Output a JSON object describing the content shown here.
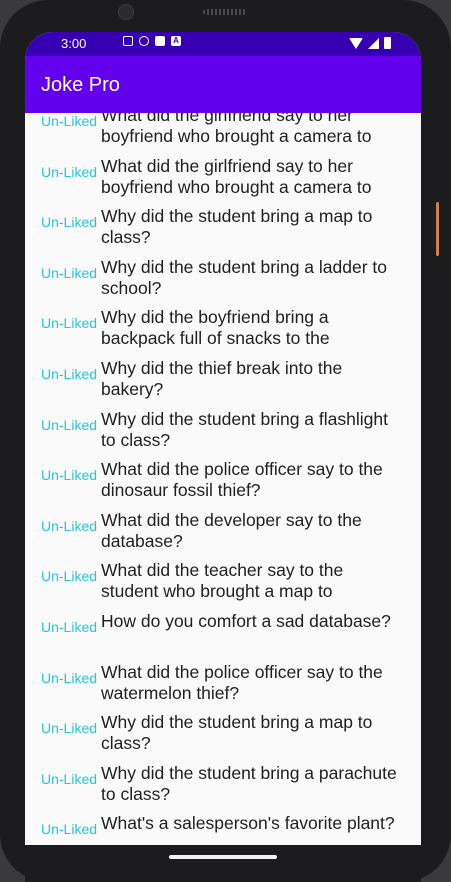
{
  "status": {
    "time": "3:00"
  },
  "app": {
    "title": "Joke Pro"
  },
  "jokes": [
    {
      "status": "Un-Liked",
      "text": "What did the girlfriend say to her boyfriend who brought a camera to"
    },
    {
      "status": "Un-Liked",
      "text": "What did the girlfriend say to her boyfriend who brought a camera to"
    },
    {
      "status": "Un-Liked",
      "text": "Why did the student bring a map to class?"
    },
    {
      "status": "Un-Liked",
      "text": "Why did the student bring a ladder to school?"
    },
    {
      "status": "Un-Liked",
      "text": "Why did the boyfriend bring a backpack full of snacks to the"
    },
    {
      "status": "Un-Liked",
      "text": "Why did the thief break into the bakery?"
    },
    {
      "status": "Un-Liked",
      "text": "Why did the student bring a flashlight to class?"
    },
    {
      "status": "Un-Liked",
      "text": "What did the police officer say to the dinosaur fossil thief?"
    },
    {
      "status": "Un-Liked",
      "text": "What did the developer say to the database?"
    },
    {
      "status": "Un-Liked",
      "text": "What did the teacher say to the student who brought a map to"
    },
    {
      "status": "Un-Liked",
      "text": "How do you comfort a sad database?"
    },
    {
      "status": "Un-Liked",
      "text": "What did the police officer say to the watermelon thief?"
    },
    {
      "status": "Un-Liked",
      "text": "Why did the student bring a map to class?"
    },
    {
      "status": "Un-Liked",
      "text": "Why did the student bring a parachute to class?"
    },
    {
      "status": "Un-Liked",
      "text": "What's a salesperson's favorite plant?"
    }
  ],
  "colors": {
    "status_bar": "#3700b3",
    "app_bar": "#6200ee",
    "unliked": "#26c6da"
  }
}
